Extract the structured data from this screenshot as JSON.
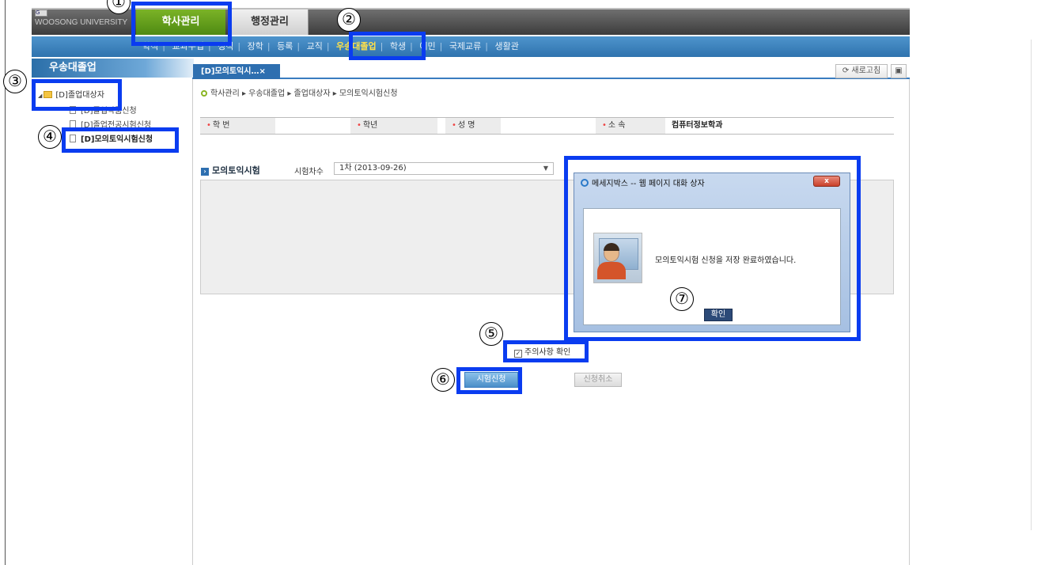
{
  "header": {
    "logo": "WOOSONG UNIVERSITY",
    "main_tabs": [
      "학사관리",
      "행정관리"
    ]
  },
  "subnav": {
    "items": [
      "학적",
      "교과수업",
      "성적",
      "장학",
      "등록",
      "교직",
      "우송대졸업",
      "학생",
      "예민",
      "국제교류",
      "생활관"
    ],
    "active": "우송대졸업"
  },
  "left_panel": {
    "title": "우송대졸업",
    "tree_root": "[D]졸업대상자",
    "tree_items": [
      "[D]졸업작품신청",
      "[D]졸업전공시험신청",
      "[D]모의토익시험신청"
    ]
  },
  "tabs": {
    "doc_tab": "[D]모의토익시…×",
    "refresh": "새로고침"
  },
  "breadcrumb": "학사관리 ▸ 우송대졸업 ▸ 졸업대상자 ▸ 모의토익시험신청",
  "info": {
    "student_no_label": "학 번",
    "grade_label": "학년",
    "name_label": "성 명",
    "dept_label": "소 속",
    "dept_value": "컴퓨터정보학과"
  },
  "section": {
    "title": "모의토익시험",
    "round_label": "시험차수",
    "round_value": "1차 (2013-09-26)"
  },
  "agree_label": "주의사항 확인",
  "buttons": {
    "apply": "시험신청",
    "cancel": "신청취소"
  },
  "dialog": {
    "title": "메세지박스 -- 웹 페이지 대화 상자",
    "message": "모의토익시험 신청을 저장 완료하였습니다.",
    "ok": "확인",
    "close": "x"
  },
  "annotations": [
    "①",
    "②",
    "③",
    "④",
    "⑤",
    "⑥",
    "⑦"
  ],
  "colors": {
    "annotation": "#0a3cf0",
    "header_active": "#5e9a1b",
    "nav_blue": "#3a7cc0",
    "nav_active_text": "#ffe14a"
  }
}
